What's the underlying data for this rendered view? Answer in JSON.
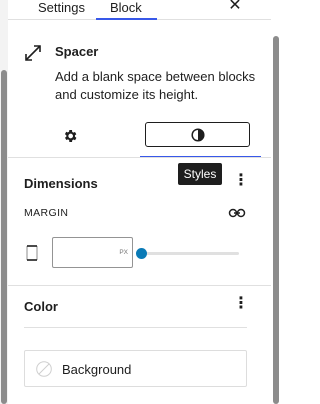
{
  "tabs": {
    "settings": "Settings",
    "block": "Block",
    "close_glyph": "✕"
  },
  "block": {
    "icon": "arrow-diagonal-icon",
    "title": "Spacer",
    "description": "Add a blank space between blocks and customize its height."
  },
  "style_tabs": {
    "settings_icon": "gear-icon",
    "styles_icon": "half-circle-icon"
  },
  "tooltip": "Styles",
  "dimensions": {
    "title": "Dimensions",
    "menu_glyph": "⋮",
    "margin_label": "MARGIN",
    "link_icon": "link-icon",
    "side_icon": "sides-icon",
    "input_value": "",
    "unit": "PX",
    "slider_value": 0
  },
  "color": {
    "title": "Color",
    "menu_glyph": "⋮",
    "background_label": "Background",
    "swatch_icon": "empty-swatch-icon"
  },
  "colors": {
    "accent": "#3858e9",
    "slider": "#0a7ab6",
    "text": "#1e1e1e",
    "tooltip_bg": "#1e1e1e"
  }
}
